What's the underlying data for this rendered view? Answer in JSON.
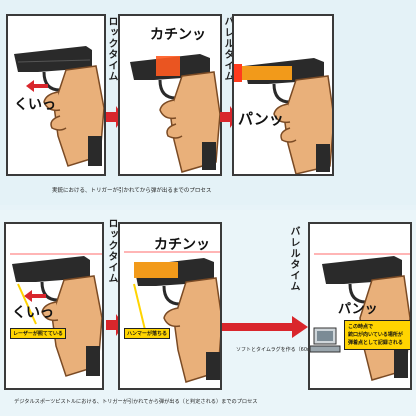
{
  "top_row": {
    "label_lock_time": "ロックタイム",
    "label_barrel_time": "バレルタイム",
    "sfx_kui": "くいっ",
    "sfx_kachin": "カチンッ",
    "sfx_pan": "パンッ",
    "caption": "実銃における、トリガーが引かれてから弾が出るまでのプロセス"
  },
  "bottom_row": {
    "label_lock_time": "ロックタイム",
    "label_barrel_time": "バレルタイム",
    "sfx_kui": "くいっ",
    "sfx_kachin": "カチンッ",
    "sfx_pan": "パンッ",
    "tag_laser": "レーザーが照てている",
    "tag_hammer": "ハンマーが落ちる",
    "arrow_note": "ソフトとタイムラグを作る（60ms）",
    "result_note_line1": "この時点で",
    "result_note_line2": "銃口が向いている場所が",
    "result_note_line3": "弾着点として記録される",
    "caption": "デジタルスポーツピストルにおける、トリガーが引かれてから弾が出る（と判定される）までのプロセス"
  },
  "colors": {
    "arrow_red": "#d9262c",
    "slide_orange": "#f29a1a",
    "note_yellow": "#ffd400",
    "skin": "#e9b07a",
    "gun": "#2a2a2a"
  }
}
